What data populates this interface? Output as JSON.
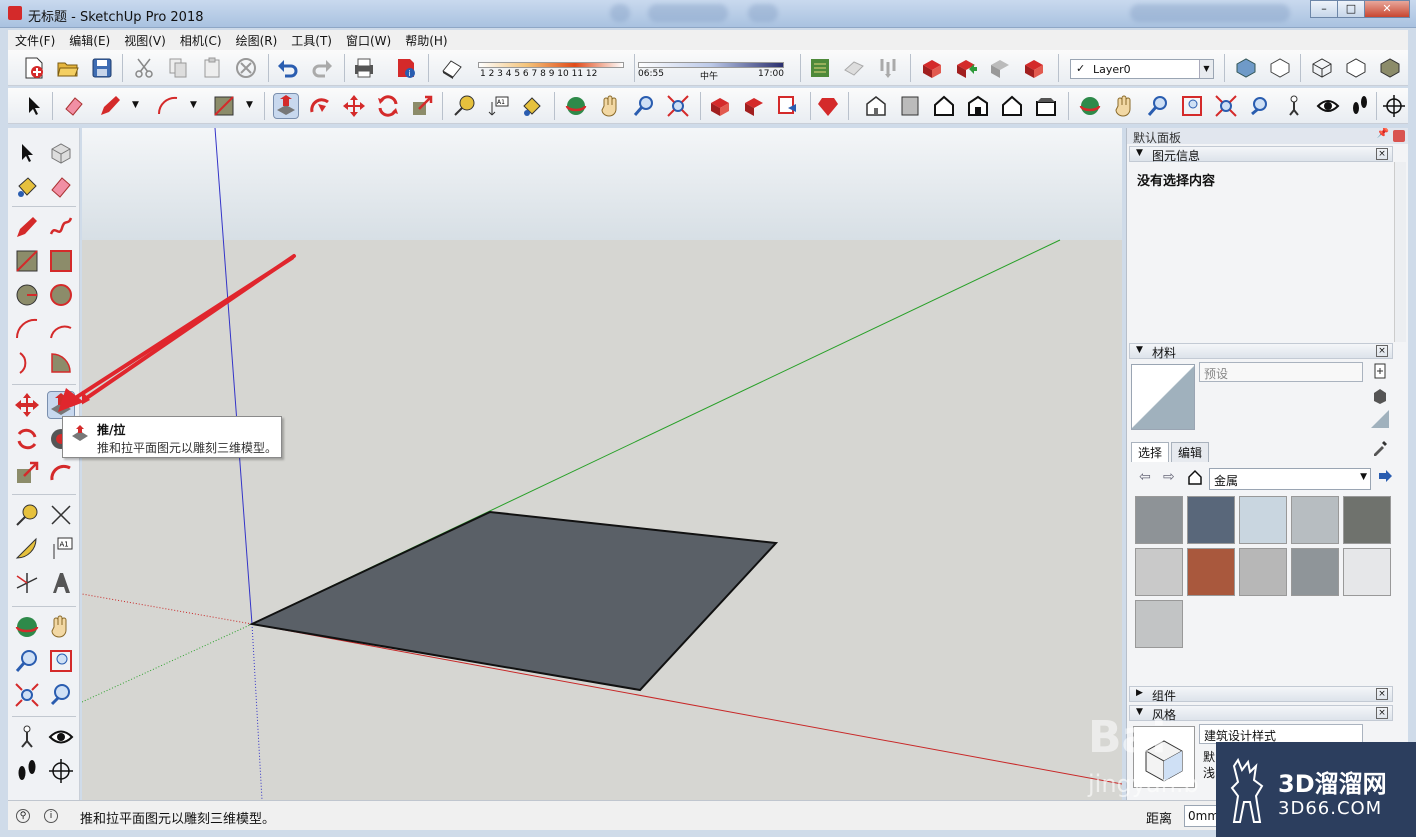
{
  "window": {
    "title": "无标题 - SketchUp Pro 2018"
  },
  "menus": [
    "文件(F)",
    "编辑(E)",
    "视图(V)",
    "相机(C)",
    "绘图(R)",
    "工具(T)",
    "窗口(W)",
    "帮助(H)"
  ],
  "shadow_scale": {
    "months": "1 2 3 4 5 6 7 8 9 10 11 12",
    "time_start": "06:55",
    "time_mid": "中午",
    "time_end": "17:00"
  },
  "layer": {
    "checked": "✓",
    "name": "Layer0"
  },
  "tooltip": {
    "title": "推/拉",
    "description": "推和拉平面图元以雕刻三维模型。"
  },
  "tray": {
    "title": "默认面板",
    "entity_info": {
      "label": "图元信息",
      "empty_text": "没有选择内容"
    },
    "materials": {
      "label": "材料",
      "name_placeholder": "预设",
      "tabs": [
        "选择",
        "编辑"
      ],
      "library": "金属",
      "swatch_colors": [
        "#8e9397",
        "#59677a",
        "#c9d6e0",
        "#b7bdc1",
        "#6f726d",
        "#c9c9c9",
        "#a9583d",
        "#b7b7b7",
        "#8f9599",
        "#e6e7e9",
        "#c2c4c5"
      ]
    },
    "components": {
      "label": "组件"
    },
    "styles": {
      "label": "风格",
      "style_name": "建筑设计样式",
      "line1": "默",
      "line2": "浅"
    }
  },
  "status": {
    "message": "推和拉平面图元以雕刻三维模型。",
    "distance_label": "距离",
    "distance_value": "0mm"
  },
  "watermark": {
    "baidu": "Bai",
    "jingyan": "jingyan.b",
    "brand": "3D溜溜网",
    "brand_url": "3D66.COM"
  },
  "colors": {
    "accent_red": "#e0262d",
    "face": "#5a6067",
    "sky": "#e8ecef",
    "ground": "#d6d6d2"
  }
}
